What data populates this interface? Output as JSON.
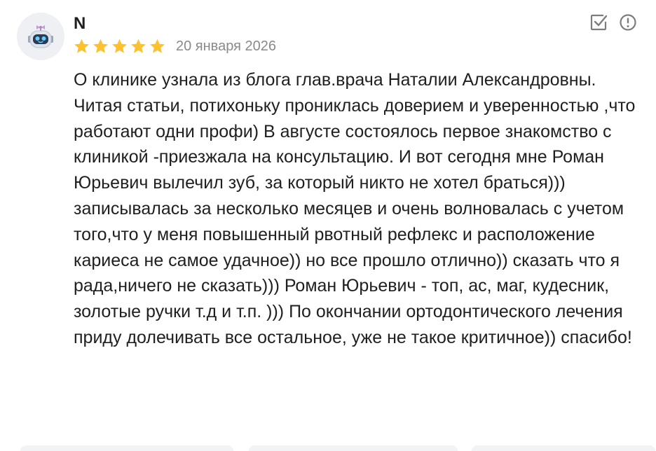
{
  "review": {
    "author": "N",
    "rating": 5,
    "date": "20 января 2026",
    "text": "О клинике узнала из блога глав.врача Наталии Александровны. Читая статьи, потихоньку прониклась доверием и уверенностью ,что работают одни профи) В августе состоялось первое знакомство с клиникой -приезжала на консультацию. И вот сегодня мне Роман Юрьевич вылечил зуб, за который никто не хотел браться))) записывалась за несколько месяцев и очень волновалась с учетом того,что у меня повышенный рвотный рефлекс и расположение кариеса не самое удачное)) но все прошло отлично)) сказать что я рада,ничего не сказать))) Роман Юрьевич - топ, ас, маг, кудесник, золотые ручки т.д и т.п. ))) По окончании ортодонтического лечения приду долечивать все остальное, уже не такое критичное)) спасибо!"
  },
  "icons": {
    "avatar": "robot-avatar-icon",
    "star": "star-icon",
    "edit": "checkbox-edit-icon",
    "report": "exclamation-circle-icon"
  },
  "colors": {
    "star": "#fcc12d",
    "text": "#21201f",
    "date": "#8a8a8a",
    "icon": "#7d7d7d",
    "chip": "#f2f3f5"
  }
}
